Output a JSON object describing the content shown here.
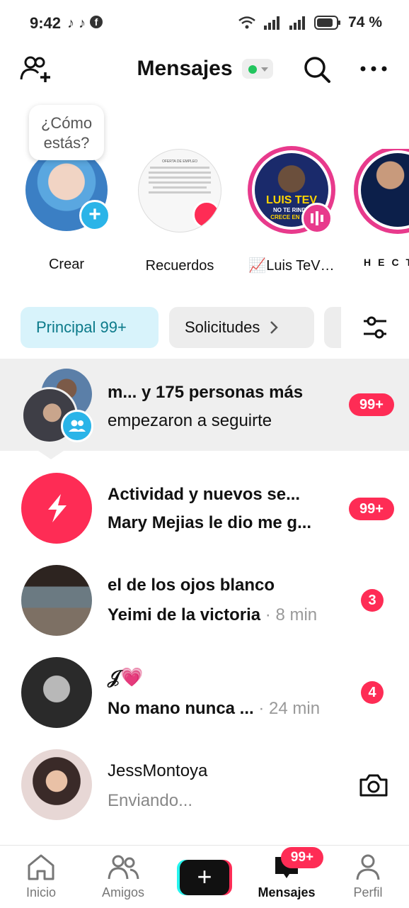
{
  "status_bar": {
    "time": "9:42",
    "battery": "74 %"
  },
  "header": {
    "title": "Mensajes"
  },
  "stories": {
    "bubble": "¿Cómo estás?",
    "items": [
      {
        "label": "Crear"
      },
      {
        "label": "Recuerdos",
        "doc_title": "OFERTA DE EMPLEO"
      },
      {
        "label": "📈Luis TeV…",
        "badge_text": "LUIS TEV",
        "badge_sub": "NO TE RINDA",
        "badge_sub2": "CRECE EN MI L"
      },
      {
        "label": "HECT"
      }
    ]
  },
  "tabs": {
    "principal": "Principal 99+",
    "solicitudes": "Solicitudes"
  },
  "messages": [
    {
      "title": "m...  y 175 personas más",
      "subtitle": "empezaron a seguirte",
      "badge": "99+"
    },
    {
      "title": "Actividad y nuevos se...",
      "subtitle": "Mary Mejias le dio me g...",
      "badge": "99+"
    },
    {
      "title": "el de los ojos blanco",
      "subtitle": "Yeimi de la victoria",
      "time": "· 8 min",
      "badge": "3"
    },
    {
      "title": "𝒥💗",
      "subtitle": "No mano nunca ...",
      "time": "· 24 min",
      "badge": "4"
    },
    {
      "title": "JessMontoya",
      "subtitle": "Enviando..."
    }
  ],
  "nav": {
    "inicio": "Inicio",
    "amigos": "Amigos",
    "mensajes": "Mensajes",
    "mensajes_badge": "99+",
    "perfil": "Perfil"
  },
  "colors": {
    "accent": "#fe2c55",
    "teal_tab_bg": "#d8f3fb",
    "teal_text": "#0b7a8a"
  }
}
